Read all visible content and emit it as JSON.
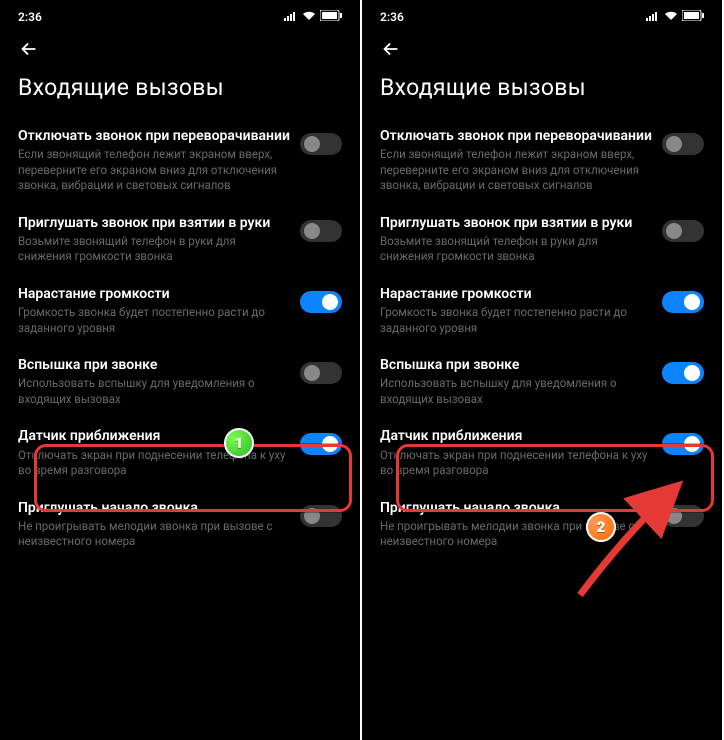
{
  "statusbar": {
    "time": "2:36"
  },
  "page_title": "Входящие вызовы",
  "items": [
    {
      "title": "Отключать звонок при переворачивании",
      "desc": "Если звонящий телефон лежит экраном вверх, переверните его экраном вниз для отключения звонка, вибрации и световых сигналов"
    },
    {
      "title": "Приглушать звонок при взятии в руки",
      "desc": "Возьмите звонящий телефон в руки для снижения громкости звонка"
    },
    {
      "title": "Нарастание громкости",
      "desc": "Громкость звонка будет постепенно расти до заданного уровня"
    },
    {
      "title": "Вспышка при звонке",
      "desc": "Использовать вспышку для уведомления о входящих вызовах"
    },
    {
      "title": "Датчик приближения",
      "desc": "Отключать экран при поднесении телефона к уху во время разговора"
    },
    {
      "title": "Приглушать начало звонка",
      "desc": "Не проигрывать мелодии звонка при вызове с неизвестного номера"
    }
  ],
  "screens": [
    {
      "toggles": [
        false,
        false,
        true,
        false,
        true,
        false
      ]
    },
    {
      "toggles": [
        false,
        false,
        true,
        true,
        true,
        false
      ]
    }
  ],
  "badges": [
    "1",
    "2"
  ]
}
